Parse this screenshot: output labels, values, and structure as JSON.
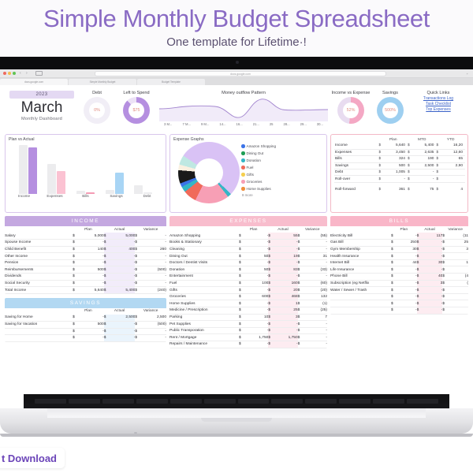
{
  "promo": {
    "title": "Simple Monthly Budget  Spreadsheet",
    "subtitle": "One template for Lifetime·!",
    "badge": "t Download"
  },
  "browser": {
    "omnibox_url": "docs.google.com",
    "share_icon": "share-icon",
    "tabs": [
      {
        "label": "docs.google.com"
      },
      {
        "label": "Simple Monthly Budget"
      },
      {
        "label": "Budget Template"
      }
    ]
  },
  "dashboard": {
    "year": "2023",
    "month": "March",
    "subtitle": "Monthly Dashboard",
    "kpis": [
      {
        "label": "Debt",
        "value": "0%",
        "pct": 0,
        "color": "#c9a9e4",
        "track": "#f1eef6"
      },
      {
        "label": "Left to Spend",
        "value": "$75",
        "pct": 88,
        "color": "#b58fe0",
        "track": "#ece2f6"
      },
      {
        "label": "Income vs Expense",
        "value": "52%",
        "pct": 52,
        "color": "#f4a8c4",
        "track": "#e8dcf0"
      },
      {
        "label": "Savings",
        "value": "500%",
        "pct": 100,
        "color": "#9ecff0",
        "track": "#ddeefb"
      }
    ],
    "outflow": {
      "title": "Money outflow Pattern",
      "xlabels": [
        "3 M...",
        "7 M...",
        "9 M...",
        "14...",
        "16...",
        "21...",
        "25",
        "28...",
        "29...",
        "30..."
      ]
    },
    "quick_links": {
      "title": "Quick Links",
      "links": [
        "Transactions Log",
        "Task Checklist",
        "Top Expenses"
      ]
    }
  },
  "chart_data": [
    {
      "type": "bar",
      "title": "Plan vs Actual",
      "categories": [
        "Income",
        "Expenses",
        "Bills",
        "Savings",
        "Debt"
      ],
      "series": [
        {
          "name": "Plan",
          "values": [
            5640,
            3450,
            324,
            500,
            1005
          ],
          "color": "#ececee"
        },
        {
          "name": "Actual",
          "values": [
            5400,
            2635,
            190,
            2500,
            0
          ],
          "color_map": [
            "#b58fe0",
            "#fbc2d2",
            "#f49bb4",
            "#a8d5f5",
            "#ececee"
          ]
        }
      ],
      "ylabel": "",
      "xlabel": "",
      "grid": false,
      "legend": "none"
    },
    {
      "type": "pie",
      "title": "Expense Graphs",
      "labels": [
        "Amazon Shopping",
        "Dining Out",
        "Donation",
        "Fuel",
        "Gifts",
        "Groceries",
        "Home Supplies"
      ],
      "colors": [
        "#3c74e8",
        "#1e9e55",
        "#35b6c6",
        "#f06a5a",
        "#f5cf4e",
        "#f79fb5",
        "#ef8f3c"
      ],
      "more_label": "8 more",
      "slices": [
        {
          "color": "#d9c2f5",
          "value": 47
        },
        {
          "color": "#35b6c6",
          "value": 2
        },
        {
          "color": "#f79fb5",
          "value": 18
        },
        {
          "color": "#f06a5a",
          "value": 7
        },
        {
          "color": "#35b6c6",
          "value": 3
        },
        {
          "color": "#3c74e8",
          "value": 2
        },
        {
          "color": "#1a1a1a",
          "value": 7
        },
        {
          "color": "#faf0e0",
          "value": 3
        },
        {
          "color": "#bfe8e2",
          "value": 5
        },
        {
          "color": "#d9c2f5",
          "value": 6
        }
      ],
      "legend": "right"
    }
  ],
  "summary": {
    "columns": [
      "",
      "Plan",
      "MTD",
      "YTD"
    ],
    "rows": [
      {
        "label": "Income",
        "plan": "5,640",
        "mtd": "5,400",
        "ytd": "16,20"
      },
      {
        "label": "Expenses",
        "plan": "3,450",
        "mtd": "2,635",
        "ytd": "12,60"
      },
      {
        "label": "Bills",
        "plan": "324",
        "mtd": "190",
        "ytd": "65"
      },
      {
        "label": "Savings",
        "plan": "500",
        "mtd": "2,500",
        "ytd": "2,90"
      },
      {
        "label": "Debt",
        "plan": "1,005",
        "mtd": "-",
        "ytd": ""
      },
      {
        "label": "Roll-over",
        "plan": "-",
        "mtd": "-",
        "ytd": ""
      }
    ],
    "rollforward": {
      "label": "Roll-forward",
      "plan": "361",
      "mtd": "75",
      "ytd": "4"
    }
  },
  "income": {
    "title": "INCOME",
    "columns": [
      "",
      "Plan",
      "Actual",
      "Variance"
    ],
    "rows": [
      {
        "name": "Salary",
        "plan": "5,000",
        "actual": "5,000",
        "variance": "-"
      },
      {
        "name": "Spouse Income",
        "plan": "-",
        "actual": "-",
        "variance": "-"
      },
      {
        "name": "Child Benefit",
        "plan": "140",
        "actual": "400",
        "variance": "260"
      },
      {
        "name": "Other Income",
        "plan": "-",
        "actual": "-",
        "variance": "-"
      },
      {
        "name": "Pension",
        "plan": "-",
        "actual": "-",
        "variance": "-"
      },
      {
        "name": "Reimbursements",
        "plan": "500",
        "actual": "-",
        "variance": "(500)"
      },
      {
        "name": "Dividends",
        "plan": "-",
        "actual": "-",
        "variance": "-"
      },
      {
        "name": "Social Security",
        "plan": "-",
        "actual": "-",
        "variance": "-"
      },
      {
        "name": "Total Income",
        "plan": "5,640",
        "actual": "5,400",
        "variance": "(240)"
      }
    ]
  },
  "savings": {
    "title": "SAVINGS",
    "columns": [
      "",
      "Plan",
      "Actual",
      "Variance"
    ],
    "rows": [
      {
        "name": "Saving for Home",
        "plan": "-",
        "actual": "2,500",
        "variance": "2,500"
      },
      {
        "name": "Saving for Vacation",
        "plan": "500",
        "actual": "-",
        "variance": "(500)"
      },
      {
        "name": "",
        "plan": "-",
        "actual": "-",
        "variance": "-"
      },
      {
        "name": "",
        "plan": "-",
        "actual": "-",
        "variance": "-"
      }
    ]
  },
  "expenses": {
    "title": "EXPENSES",
    "columns": [
      "",
      "Plan",
      "Actual",
      "Variance"
    ],
    "rows": [
      {
        "name": "Amazon Shopping",
        "plan": "-",
        "actual": "55",
        "variance": "(55)"
      },
      {
        "name": "Books & Stationary",
        "plan": "-",
        "actual": "-",
        "variance": "-"
      },
      {
        "name": "Cleaning",
        "plan": "-",
        "actual": "-",
        "variance": "-"
      },
      {
        "name": "Dining Out",
        "plan": "50",
        "actual": "19",
        "variance": "31"
      },
      {
        "name": "Doctors / Dentist Visits",
        "plan": "-",
        "actual": "-",
        "variance": "-"
      },
      {
        "name": "Donation",
        "plan": "50",
        "actual": "83",
        "variance": "(33)"
      },
      {
        "name": "Entertainment",
        "plan": "-",
        "actual": "-",
        "variance": "-"
      },
      {
        "name": "Fuel",
        "plan": "100",
        "actual": "160",
        "variance": "(60)"
      },
      {
        "name": "Gifts",
        "plan": "-",
        "actual": "20",
        "variance": "(20)"
      },
      {
        "name": "Groceries",
        "plan": "600",
        "actual": "468",
        "variance": "132"
      },
      {
        "name": "Home Supplies",
        "plan": "-",
        "actual": "1",
        "variance": "(1)"
      },
      {
        "name": "Medicine / Prescription",
        "plan": "-",
        "actual": "25",
        "variance": "(25)"
      },
      {
        "name": "Parking",
        "plan": "10",
        "actual": "3",
        "variance": "7"
      },
      {
        "name": "Pet Supplies",
        "plan": "-",
        "actual": "-",
        "variance": "-"
      },
      {
        "name": "Public Transporation",
        "plan": "-",
        "actual": "-",
        "variance": "-"
      },
      {
        "name": "Rent / Mortgage",
        "plan": "1,750",
        "actual": "1,750",
        "variance": "-"
      },
      {
        "name": "Repairs / Maintenance",
        "plan": "-",
        "actual": "-",
        "variance": "-"
      }
    ]
  },
  "bills": {
    "title": "BILLS",
    "columns": [
      "",
      "Plan",
      "Actual",
      "Variance"
    ],
    "rows": [
      {
        "name": "Electricity Bill",
        "plan": "-",
        "actual": "117",
        "variance": "(11"
      },
      {
        "name": "Gas Bill",
        "plan": "250",
        "actual": "-",
        "variance": "25"
      },
      {
        "name": "Gym Membership",
        "plan": "30",
        "actual": "-",
        "variance": "3"
      },
      {
        "name": "Health Insurance",
        "plan": "-",
        "actual": "-",
        "variance": ""
      },
      {
        "name": "Internet Bill",
        "plan": "44",
        "actual": "30",
        "variance": "1"
      },
      {
        "name": "Life Insurance",
        "plan": "-",
        "actual": "-",
        "variance": ""
      },
      {
        "name": "Phone Bill",
        "plan": "-",
        "actual": "40",
        "variance": "(4"
      },
      {
        "name": "Subscription (eg Netflix",
        "plan": "-",
        "actual": "3",
        "variance": "("
      },
      {
        "name": "Water / Sewer / Trash",
        "plan": "-",
        "actual": "-",
        "variance": ""
      },
      {
        "name": "",
        "plan": "-",
        "actual": "-",
        "variance": ""
      },
      {
        "name": "",
        "plan": "-",
        "actual": "-",
        "variance": ""
      },
      {
        "name": "",
        "plan": "-",
        "actual": "-",
        "variance": ""
      }
    ]
  },
  "currency_symbol": "$",
  "colors": {
    "brand_purple": "#8a6bc4",
    "income_header": "#c4a8e0",
    "savings_header": "#b2d8f2",
    "expenses_header": "#f8bdcd",
    "bills_header": "#f9b6c8"
  }
}
